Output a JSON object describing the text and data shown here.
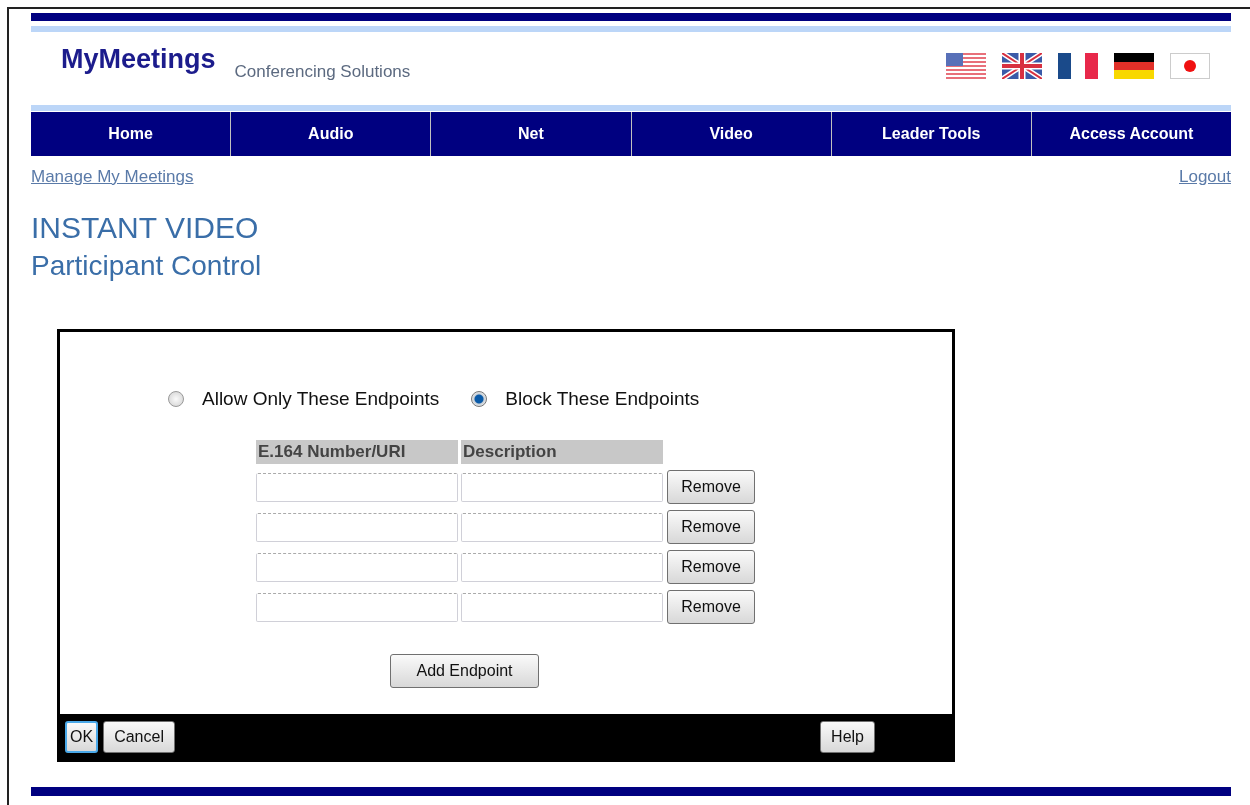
{
  "header": {
    "logo": "MyMeetings",
    "tagline": "Conferencing Solutions",
    "flags": [
      {
        "kind": "us"
      },
      {
        "kind": "uk"
      },
      {
        "kind": "fr"
      },
      {
        "kind": "de"
      },
      {
        "kind": "jp"
      }
    ]
  },
  "nav": [
    "Home",
    "Audio",
    "Net",
    "Video",
    "Leader Tools",
    "Access Account"
  ],
  "links": {
    "left": "Manage My Meetings",
    "right": "Logout"
  },
  "title": "INSTANT VIDEO",
  "subtitle": "Participant Control",
  "dialog": {
    "options": [
      {
        "label": "Allow Only These Endpoints",
        "selected": false
      },
      {
        "label": "Block These Endpoints",
        "selected": true
      }
    ],
    "columns": [
      "E.164 Number/URI",
      "Description"
    ],
    "rows": [
      {
        "number": "",
        "description": "",
        "action": "Remove"
      },
      {
        "number": "",
        "description": "",
        "action": "Remove"
      },
      {
        "number": "",
        "description": "",
        "action": "Remove"
      },
      {
        "number": "",
        "description": "",
        "action": "Remove"
      }
    ],
    "add_button": "Add Endpoint",
    "footer_left": [
      {
        "label": "OK",
        "focused": true
      },
      {
        "label": "Cancel",
        "focused": false
      }
    ],
    "footer_right": [
      {
        "label": "Help",
        "focused": false
      }
    ]
  }
}
